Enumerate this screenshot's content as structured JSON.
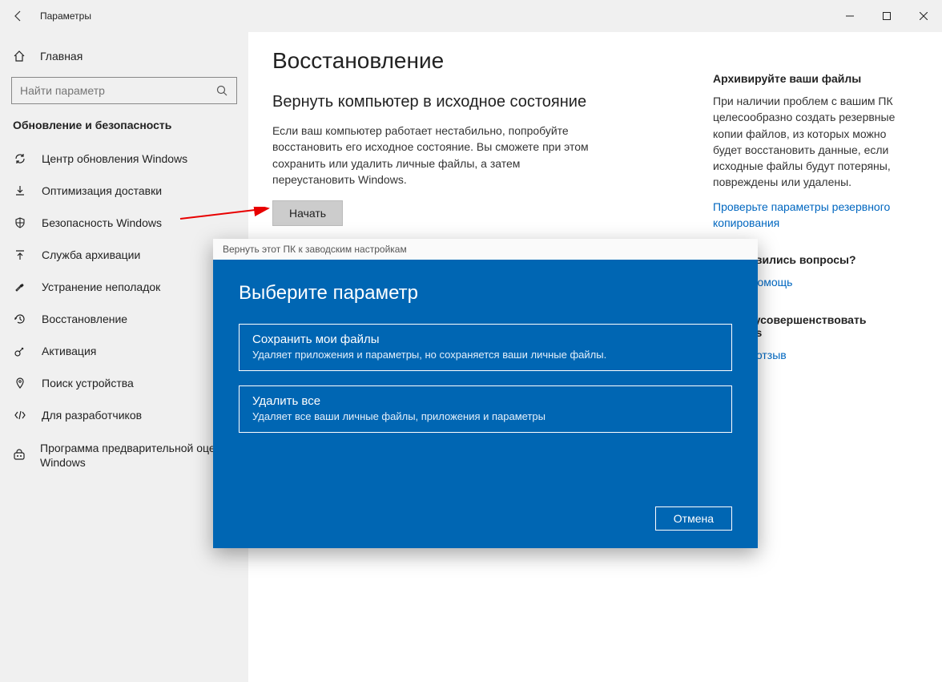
{
  "window": {
    "title": "Параметры"
  },
  "sidebar": {
    "home": "Главная",
    "search_placeholder": "Найти параметр",
    "category": "Обновление и безопасность",
    "items": [
      {
        "label": "Центр обновления Windows"
      },
      {
        "label": "Оптимизация доставки"
      },
      {
        "label": "Безопасность Windows"
      },
      {
        "label": "Служба архивации"
      },
      {
        "label": "Устранение неполадок"
      },
      {
        "label": "Восстановление"
      },
      {
        "label": "Активация"
      },
      {
        "label": "Поиск устройства"
      },
      {
        "label": "Для разработчиков"
      },
      {
        "label": "Программа предварительной оценки Windows"
      }
    ]
  },
  "main": {
    "heading": "Восстановление",
    "section1_title": "Вернуть компьютер в исходное состояние",
    "section1_body": "Если ваш компьютер работает нестабильно, попробуйте восстановить его исходное состояние. Вы сможете при этом сохранить или удалить личные файлы, а затем переустановить Windows.",
    "start_button": "Начать"
  },
  "right": {
    "h1": "Архивируйте ваши файлы",
    "p1": "При наличии проблем с вашим ПК целесообразно создать резервные копии файлов, из которых можно будет восстановить данные, если исходные файлы будут потеряны, повреждены или удалены.",
    "link1": "Проверьте параметры резервного копирования",
    "h2": "вас появились вопросы?",
    "link2": "лучить помощь",
    "h3": "могите усовершенствовать Windows",
    "link3": "ставить отзыв"
  },
  "dialog": {
    "titlebar": "Вернуть этот ПК к заводским настройкам",
    "heading": "Выберите параметр",
    "option1_title": "Сохранить мои файлы",
    "option1_desc": "Удаляет приложения и параметры, но сохраняется ваши личные файлы.",
    "option2_title": "Удалить все",
    "option2_desc": "Удаляет все ваши личные файлы, приложения и параметры",
    "cancel": "Отмена"
  }
}
